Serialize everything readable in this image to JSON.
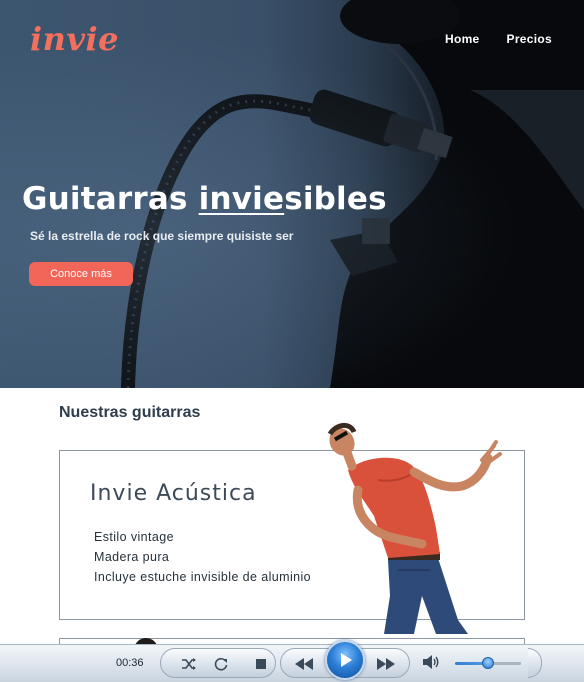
{
  "header": {
    "logo": "invie",
    "nav": [
      "Home",
      "Precios"
    ]
  },
  "hero": {
    "title_pre": "Guitarras ",
    "title_underlined": "invie",
    "title_post": "sibles",
    "subtitle": "Sé la estrella de rock que siempre quisiste ser",
    "cta_label": "Conoce más"
  },
  "guitars": {
    "section_title": "Nuestras guitarras",
    "items": [
      {
        "name": "Invie Acústica",
        "features": [
          "Estilo vintage",
          "Madera pura",
          "Incluye estuche invisible de aluminio"
        ]
      }
    ]
  },
  "player": {
    "time": "00:36",
    "volume_level": 0.5
  },
  "colors": {
    "brand": "#f2705d",
    "cta": "#f2665a",
    "player_accent": "#2d7fd6"
  }
}
